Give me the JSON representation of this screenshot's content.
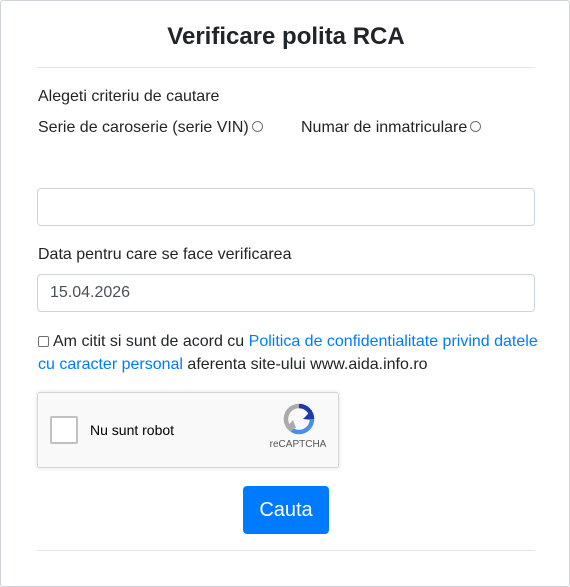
{
  "form": {
    "title": "Verificare polita RCA",
    "criteria_label": "Alegeti criteriu de cautare",
    "options": [
      {
        "label": "Serie de caroserie (serie VIN)",
        "selected": false
      },
      {
        "label": "Numar de inmatriculare",
        "selected": false
      }
    ],
    "search_value": "",
    "date_label": "Data pentru care se face verificarea",
    "date_value": "15.04.2026",
    "agree": {
      "checked": false,
      "text_before": "Am citit si sunt de acord cu ",
      "link_text": "Politica de confidentialitate privind datele cu caracter personal",
      "text_after": " aferenta site-ului www.aida.info.ro"
    },
    "captcha": {
      "label": "Nu sunt robot",
      "brand": "reCAPTCHA",
      "icon": "recaptcha-logo-icon"
    },
    "submit_label": "Cauta"
  },
  "colors": {
    "accent": "#007bff",
    "text": "#212529",
    "border": "#ced4da"
  }
}
